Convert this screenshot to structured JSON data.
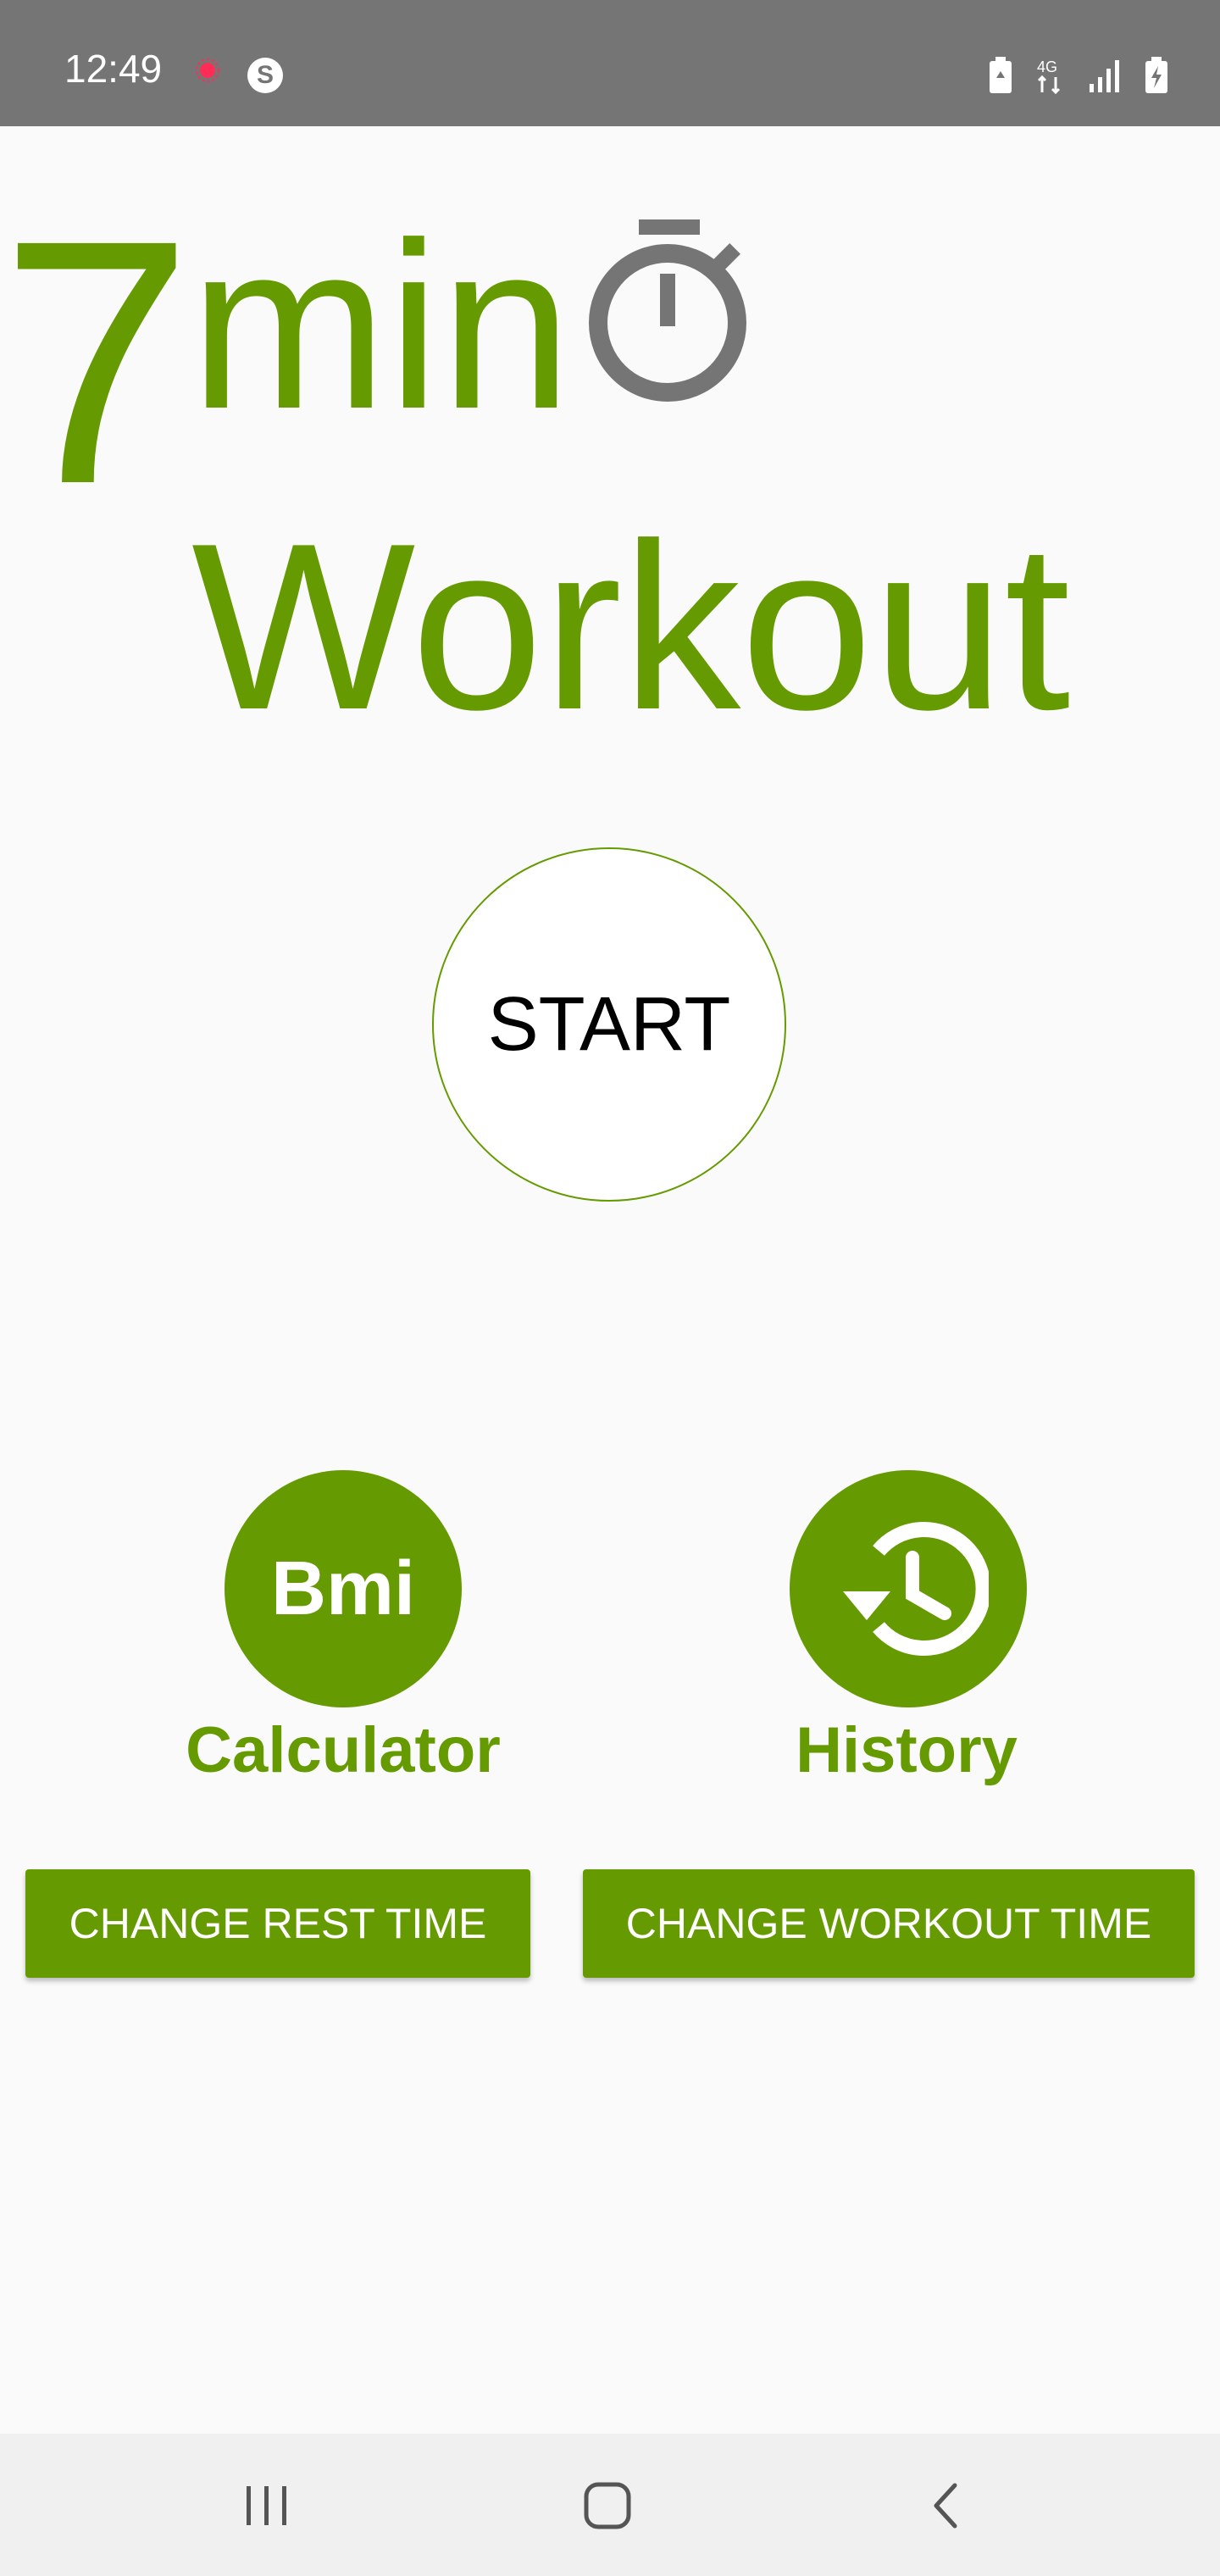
{
  "status_bar": {
    "time": "12:49",
    "network": "4G",
    "icons": [
      "recording-dot-icon",
      "s-app-icon",
      "battery-saver-icon",
      "network-4g-icon",
      "signal-icon",
      "battery-charging-icon"
    ]
  },
  "title": {
    "number": "7",
    "unit": "min",
    "word": "Workout",
    "icon": "stopwatch-icon"
  },
  "start_button": {
    "label": "START"
  },
  "bmi": {
    "icon_text": "Bmi",
    "label": "Calculator"
  },
  "history": {
    "icon": "history-icon",
    "label": "History"
  },
  "buttons": {
    "change_rest_time": "CHANGE REST TIME",
    "change_workout_time": "CHANGE WORKOUT TIME"
  },
  "nav_bar": {
    "items": [
      "recents-icon",
      "home-icon",
      "back-icon"
    ]
  },
  "colors": {
    "accent": "#659a00",
    "status_bar": "#757575",
    "background": "#fafafa",
    "stopwatch": "#757575"
  }
}
